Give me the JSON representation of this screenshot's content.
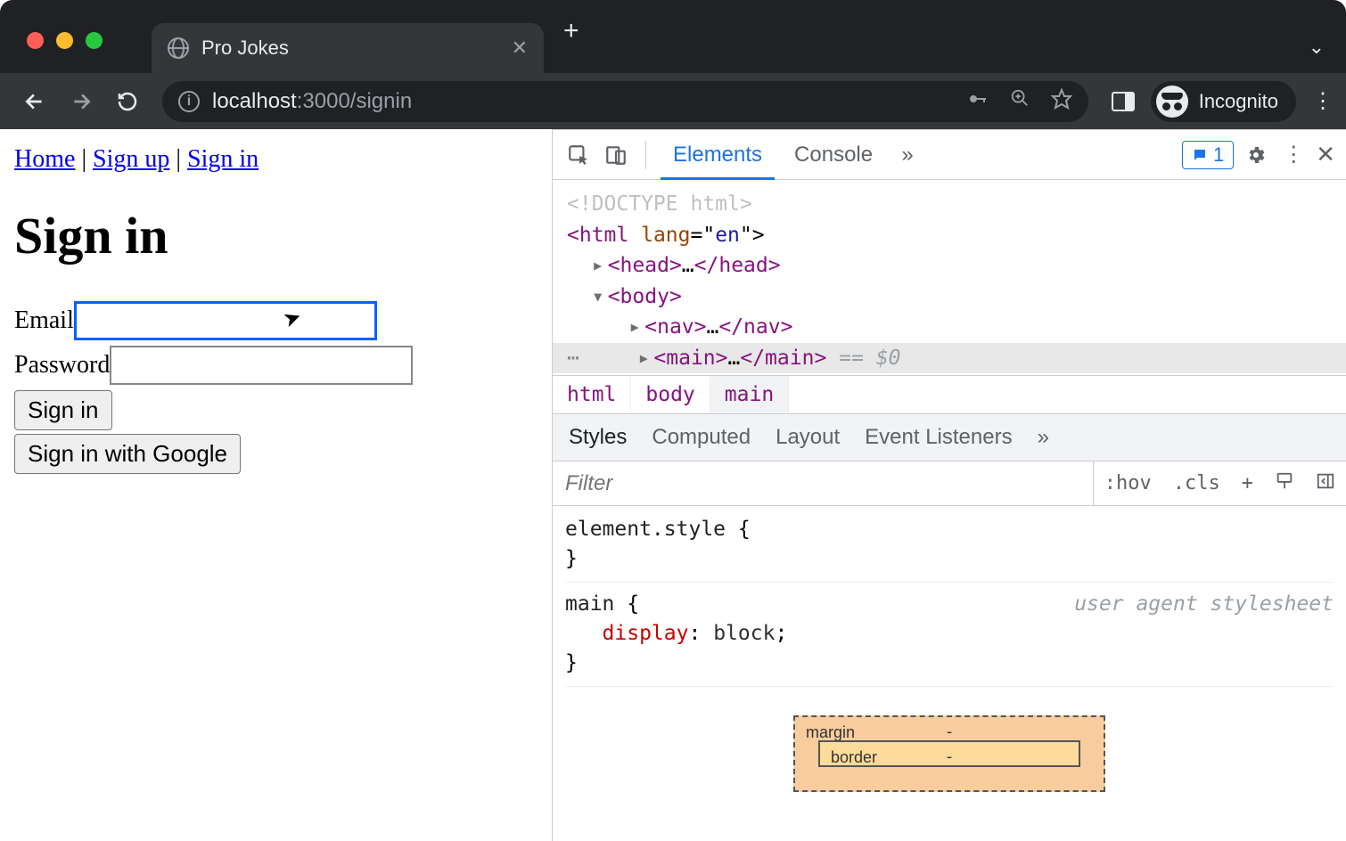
{
  "browser": {
    "tab_title": "Pro Jokes",
    "url_host": "localhost",
    "url_port_path": ":3000/signin",
    "incognito_label": "Incognito",
    "issues_count": "1"
  },
  "page": {
    "nav": {
      "home": "Home",
      "signup": "Sign up",
      "signin": "Sign in",
      "sep": " | "
    },
    "heading": "Sign in",
    "email_label": "Email",
    "password_label": "Password",
    "signin_btn": "Sign in",
    "google_btn": "Sign in with Google"
  },
  "devtools": {
    "tabs": {
      "elements": "Elements",
      "console": "Console"
    },
    "dom": {
      "doctype": "<!DOCTYPE html>",
      "html_open": "<",
      "html_tag": "html",
      "lang_attr": " lang",
      "lang_eq": "=\"",
      "lang_val": "en",
      "lang_close": "\">",
      "head_open": "<head>",
      "head_ellipsis": "…",
      "head_close": "</head>",
      "body_open": "<body>",
      "nav_open": "<nav>",
      "nav_close": "</nav>",
      "main_open": "<main>",
      "main_close": "</main>",
      "eq0": "== $0"
    },
    "breadcrumb": {
      "a": "html",
      "b": "body",
      "c": "main"
    },
    "styles_tabs": {
      "styles": "Styles",
      "computed": "Computed",
      "layout": "Layout",
      "listeners": "Event Listeners"
    },
    "styles_toolbar": {
      "filter_placeholder": "Filter",
      "hov": ":hov",
      "cls": ".cls",
      "plus": "+"
    },
    "rules": {
      "element_style": "element.style",
      "brace_open": " {",
      "brace_close": "}",
      "main_sel": "main",
      "ua_label": "user agent stylesheet",
      "display_prop": "display",
      "display_val": "block",
      "colon": ": ",
      "semi": ";"
    },
    "boxmodel": {
      "margin_label": "margin",
      "border_label": "border",
      "dash": "-"
    }
  }
}
